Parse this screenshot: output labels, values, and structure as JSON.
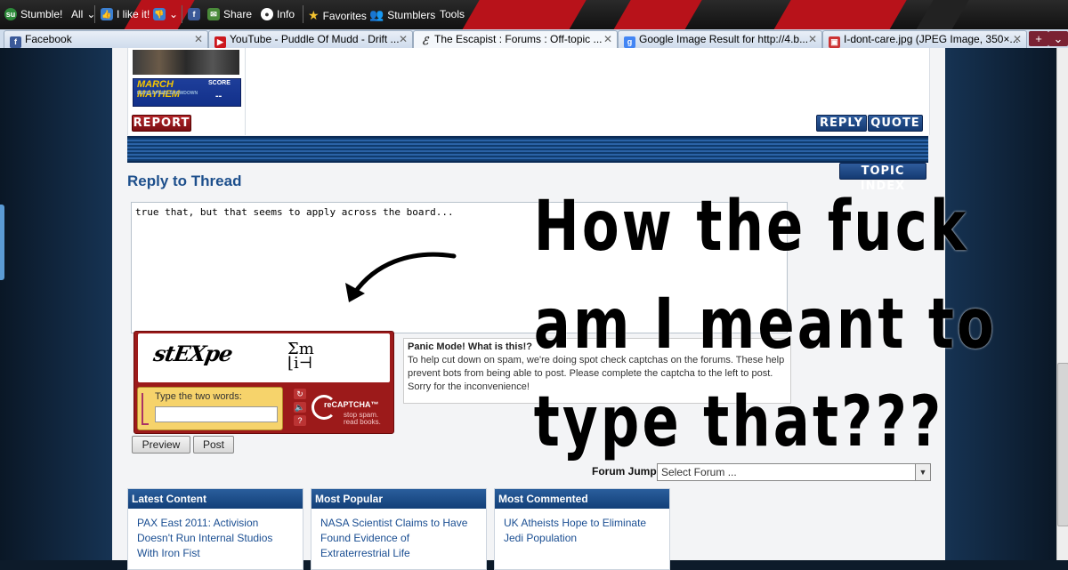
{
  "toolbar": {
    "stumble": "Stumble!",
    "all": "All",
    "like": "I like it!",
    "share": "Share",
    "info": "Info",
    "favorites": "Favorites",
    "stumblers": "Stumblers",
    "tools": "Tools"
  },
  "tabs": [
    {
      "label": "Facebook"
    },
    {
      "label": "YouTube - Puddle Of Mudd - Drift ..."
    },
    {
      "label": "The Escapist : Forums : Off-topic ..."
    },
    {
      "label": "Google Image Result for http://4.b..."
    },
    {
      "label": "I-dont-care.jpg (JPEG Image, 350×..."
    }
  ],
  "post": {
    "badge_title": "MARCH MAYHEM",
    "badge_sub": "DEVELOPERS' SHOWDOWN",
    "badge_score_label": "SCORE",
    "badge_score": "--",
    "report": "REPORT",
    "reply": "REPLY",
    "quote": "QUOTE"
  },
  "topic_index": "TOPIC INDEX",
  "reply_title": "Reply to Thread",
  "reply_text": "true that, but that seems to apply across the board...",
  "captcha": {
    "word1": "stEXpe",
    "word2": "Σm ⌊i⊣",
    "prompt": "Type the two words:",
    "brand": "reCAPTCHA™",
    "tagline1": "stop spam.",
    "tagline2": "read books.",
    "help_title": "Panic Mode! What is this!?",
    "help_text": "To help cut down on spam, we're doing spot check captchas on the forums. These help prevent bots from being able to post. Please complete the captcha to the left to post. Sorry for the inconvenience!"
  },
  "buttons": {
    "preview": "Preview",
    "post": "Post"
  },
  "forum_jump": {
    "label": "Forum Jump:",
    "selected": "Select Forum ..."
  },
  "panels": [
    {
      "title": "Latest Content",
      "text": "PAX East 2011: Activision Doesn't Run Internal Studios With Iron Fist"
    },
    {
      "title": "Most Popular",
      "text": "NASA Scientist Claims to Have Found Evidence of Extraterrestrial Life"
    },
    {
      "title": "Most Commented",
      "text": "UK Atheists Hope to Eliminate Jedi Population"
    }
  ],
  "meme": {
    "line1": "How the fuck",
    "line2": "am I meant to",
    "line3": "type that???"
  }
}
